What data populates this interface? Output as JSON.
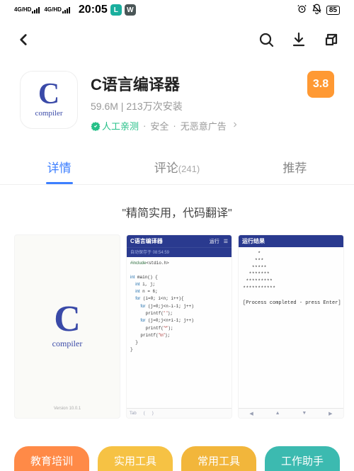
{
  "status_bar": {
    "network_label": "4G/HD",
    "time": "20:05",
    "battery_pct": "85",
    "icons": {
      "l": "L",
      "w": "W"
    }
  },
  "app": {
    "icon_letter": "C",
    "icon_sub": "compiler",
    "title": "C语言编译器",
    "size": "59.6M",
    "installs": "213万次安装",
    "tags": {
      "verified": "人工亲测",
      "safe": "安全",
      "noads": "无恶意广告"
    },
    "rating": "3.8"
  },
  "tabs": {
    "details": "详情",
    "comments": "评论",
    "comment_count": "(241)",
    "recommend": "推荐"
  },
  "tagline": "\"精简实用，代码翻译\"",
  "screenshots": {
    "splash": {
      "c": "C",
      "sub": "compiler",
      "version": "Version 10.0.1"
    },
    "editor": {
      "title": "C语言编译器",
      "run": "运行",
      "menu": "☰",
      "saved_at": "自动保存于 08:54:59",
      "code": "#include<stdio.h>\n\nint main() {\n  int i, j;\n  int n = 6;\n  for (i=0; i<n; i++){\n    for (j=0;j<n-i-1; j++)\n      printf(\" \");\n    for (j=0;j<n+i-1; j++)\n      printf(\"*\");\n    printf(\"\\n\");\n  }\n}",
      "bottom": {
        "tab": "Tab",
        "l": "(",
        "r": ")"
      }
    },
    "result": {
      "title": "运行结果",
      "output": "     *\n    ***\n   *****\n  *******\n *********\n***********\n\n[Process completed - press Enter]",
      "keys": {
        "left": "◀",
        "up": "▲",
        "down": "▼",
        "right": "▶"
      }
    }
  },
  "categories": {
    "c1": "教育培训",
    "c2": "实用工具",
    "c3": "常用工具",
    "c4": "工作助手"
  }
}
